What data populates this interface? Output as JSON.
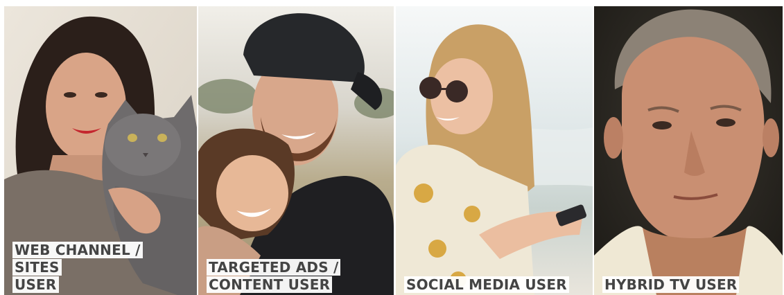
{
  "panels": [
    {
      "label_lines": [
        "WEB CHANNEL / SITES",
        "USER"
      ],
      "photo": "woman-with-grey-cat"
    },
    {
      "label_lines": [
        "TARGETED ADS /",
        "CONTENT USER"
      ],
      "photo": "bearded-man-hugging-child"
    },
    {
      "label_lines": [
        "SOCIAL MEDIA USER"
      ],
      "photo": "woman-with-sunglasses-and-phone-at-beach"
    },
    {
      "label_lines": [
        "HYBRID TV USER"
      ],
      "photo": "older-man-portrait"
    }
  ],
  "colors": {
    "label_text": "#444444",
    "label_background": "#ffffff"
  }
}
